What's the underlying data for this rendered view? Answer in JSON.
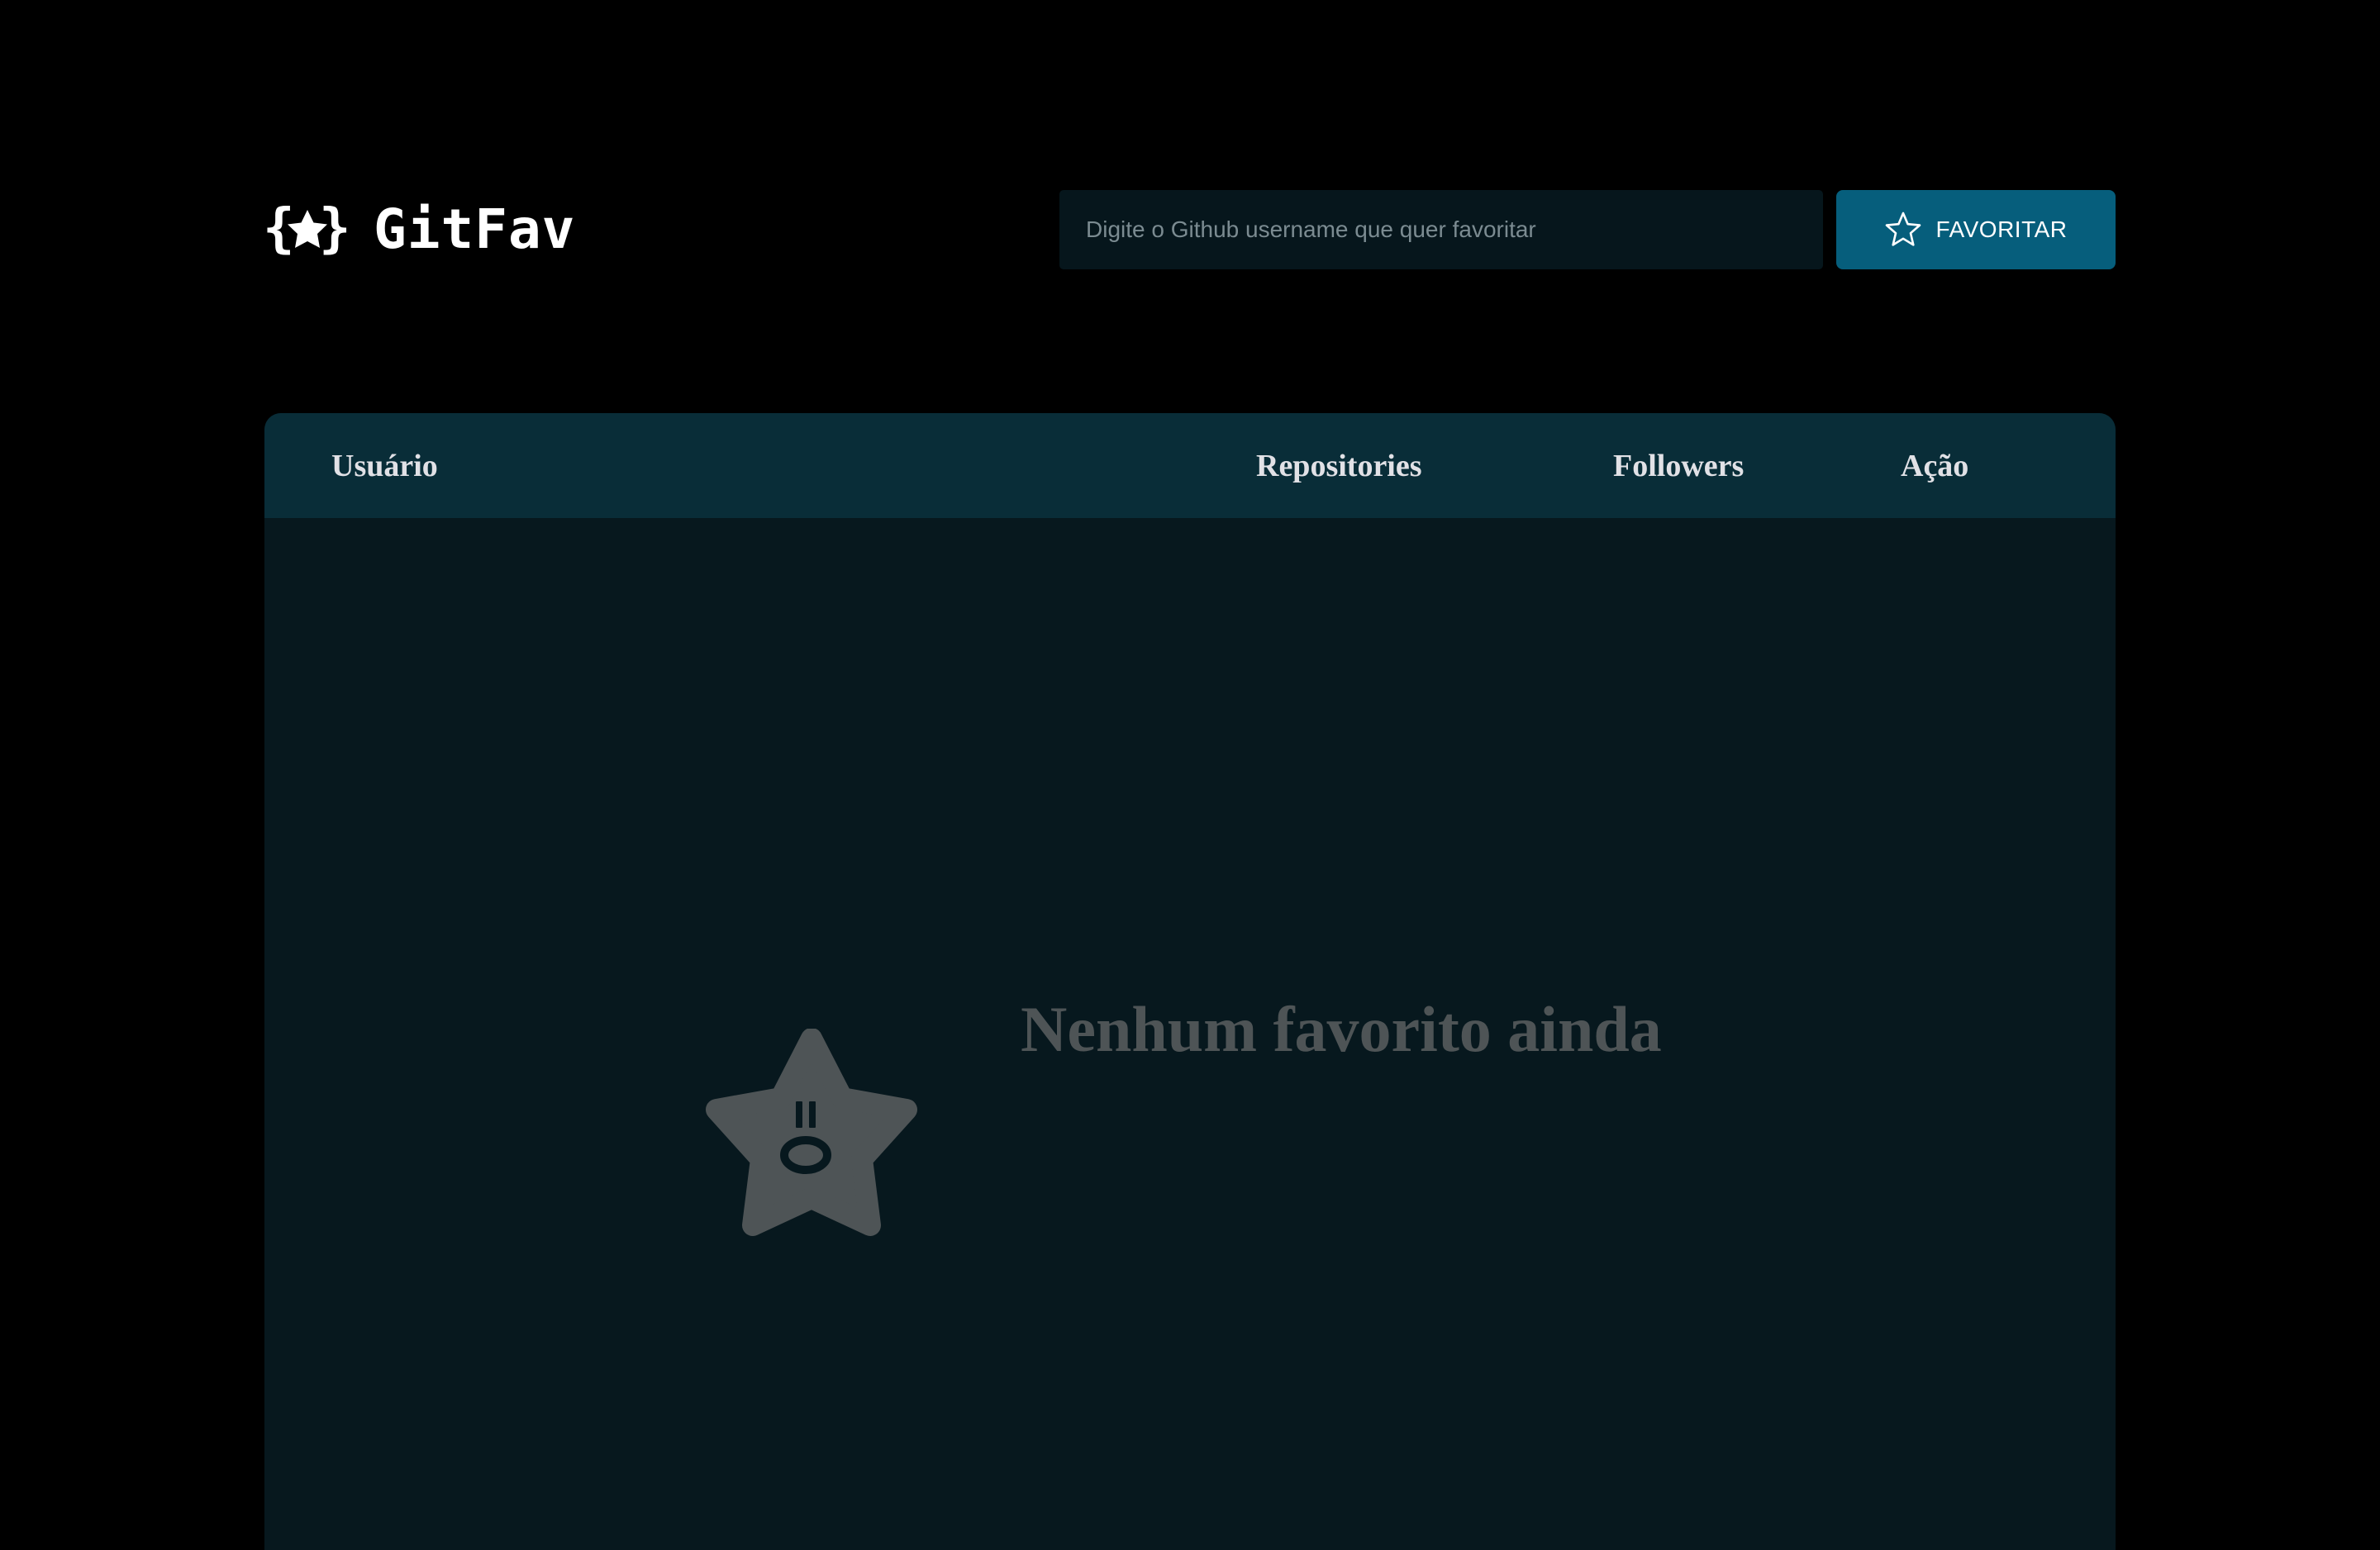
{
  "app": {
    "name": "GitFav",
    "logo_icon": "braces-star-icon"
  },
  "search": {
    "placeholder": "Digite o Github username que quer favoritar",
    "value": "",
    "button_label": "FAVORITAR",
    "button_icon": "star-outline-icon"
  },
  "table": {
    "columns": [
      "Usuário",
      "Repositories",
      "Followers",
      "Ação"
    ],
    "rows": []
  },
  "empty_state": {
    "icon": "sad-star-icon",
    "message": "Nenhum favorito ainda"
  },
  "colors": {
    "background": "#000000",
    "accent": "#065e7c",
    "table_header": "#092d38",
    "table_body": "#07181e",
    "input_background": "#06161c",
    "empty_state": "#4e5456"
  }
}
